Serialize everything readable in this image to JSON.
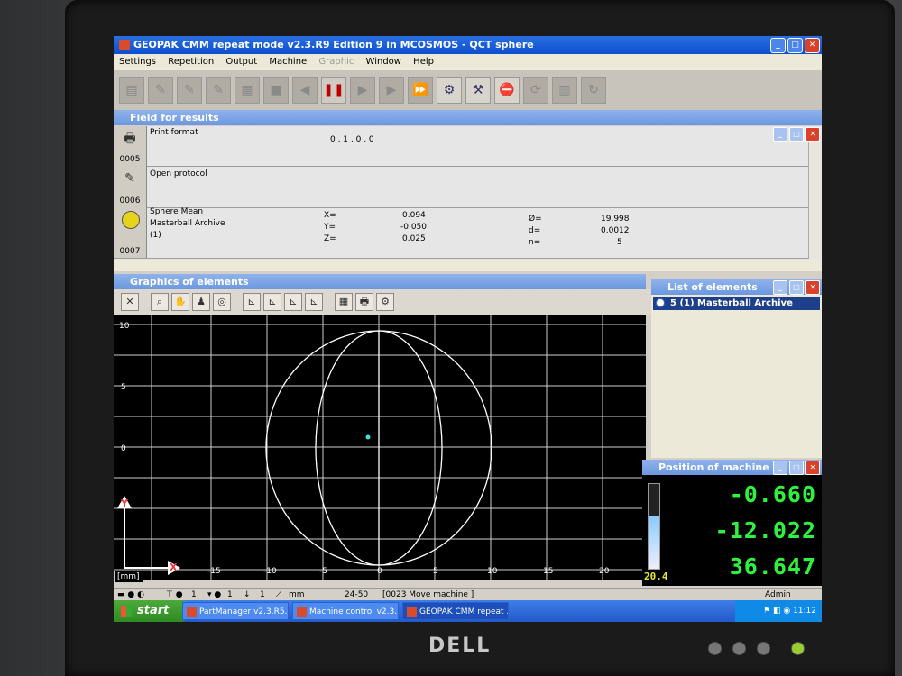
{
  "window": {
    "title": "GEOPAK CMM repeat mode v2.3.R9 Edition 9 in MCOSMOS - QCT sphere"
  },
  "menu": [
    "Settings",
    "Repetition",
    "Output",
    "Machine",
    "Graphic",
    "Window",
    "Help"
  ],
  "results_panel": {
    "title": "Field for results",
    "rows": [
      {
        "num": "0005",
        "label": "Print format",
        "value": "0 , 1 , 0 , 0"
      },
      {
        "num": "0006",
        "label": "Open protocol"
      },
      {
        "num": "0007",
        "label1": "Sphere Mean",
        "label2": "Masterball Archive",
        "label3": "(1)",
        "x_label": "X=",
        "x_val": "0.094",
        "y_label": "Y=",
        "y_val": "-0.050",
        "z_label": "Z=",
        "z_val": "0.025",
        "dia_label": "Ø=",
        "dia_val": "19.998",
        "d_label": "d=",
        "d_val": "0.0012",
        "n_label": "n=",
        "n_val": "5"
      }
    ]
  },
  "graphics_panel": {
    "title": "Graphics of elements",
    "y_ticks": [
      "10",
      "5",
      "0"
    ],
    "x_ticks": [
      "-15",
      "-10",
      "-5",
      "0",
      "5",
      "10",
      "15",
      "20"
    ],
    "unit": "[mm]",
    "axis_y": "Y",
    "axis_x": "X"
  },
  "list_panel": {
    "title": "List of elements",
    "item": "5 (1) Masterball Archive"
  },
  "position_panel": {
    "title": "Position of machine",
    "x": "-0.660",
    "y": "-12.022",
    "z": "36.647",
    "temperature": "20.4"
  },
  "statusbar": {
    "count1": "1",
    "count2": "1",
    "count3": "1",
    "unit": "mm",
    "code": "24-50",
    "message": "[0023 Move machine ]",
    "user": "Admin"
  },
  "taskbar": {
    "start": "start",
    "tasks": [
      "PartManager v2.3.R5...",
      "Machine control v2.3....",
      "GEOPAK CMM repeat ..."
    ],
    "time": "11:12"
  },
  "monitor": {
    "brand": "DELL"
  }
}
